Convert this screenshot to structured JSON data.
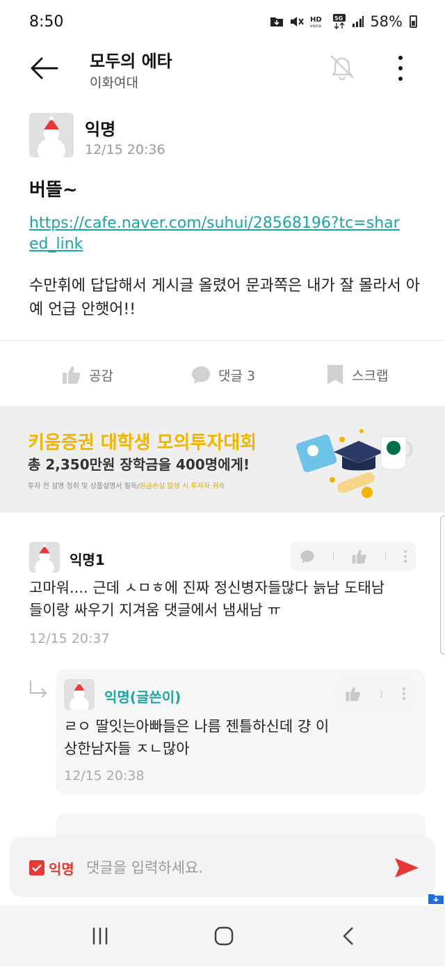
{
  "status_bar": {
    "time": "8:50",
    "battery": "58%"
  },
  "header": {
    "title": "모두의 에타",
    "subtitle": "이화여대"
  },
  "post": {
    "author": "익명",
    "time": "12/15 20:36",
    "title": "버뜰~",
    "link": "https://cafe.naver.com/suhui/28568196?tc=shared_link",
    "body": "수만휘에 답답해서 게시글 올렸어 문과쪽은 내가 잘 몰라서 아예 언급 안햇어!!"
  },
  "actions": {
    "like_label": "공감",
    "comment_label": "댓글 3",
    "scrap_label": "스크랩"
  },
  "banner": {
    "line1": "키움증권 대학생 모의투자대회",
    "line2": "총 2,350만원 장학금을 400명에게!",
    "notice_main": "투자 전 설명 청취 및 상품설명서 필독/",
    "notice_highlight": "원금손실 발생 시 투자자 귀속"
  },
  "comments": [
    {
      "author": "익명1",
      "body": "고마워.... 근데 ㅅㅁㅎ에 진짜 정신병자들많다 늙남 도태남들이랑 싸우기 지겨움 댓글에서 냄새남 ㅠ",
      "time": "12/15 20:37"
    }
  ],
  "replies": [
    {
      "author": "익명(글쓴이)",
      "body": "ㄹㅇ 딸잇는아빠들은 나름 젠틀하신데 걍 이상한남자들 ㅈㄴ많아",
      "time": "12/15 20:38"
    }
  ],
  "input": {
    "anon_label": "익명",
    "placeholder": "댓글을 입력하세요."
  },
  "colors": {
    "accent_teal": "#19a6a6",
    "accent_red": "#e53935",
    "banner_yellow": "#f2b400"
  }
}
